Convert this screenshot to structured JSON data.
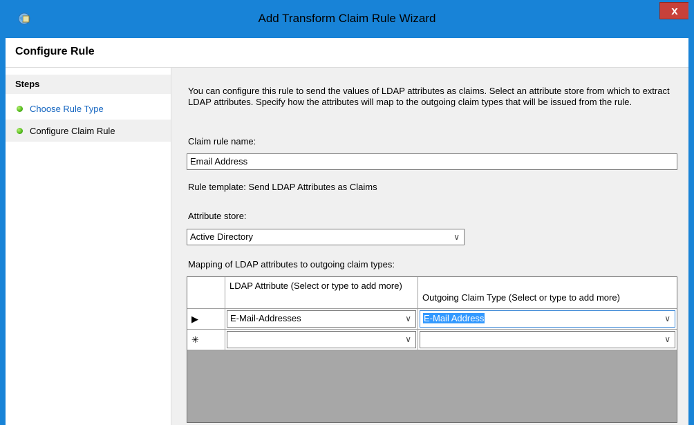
{
  "window": {
    "title": "Add Transform Claim Rule Wizard",
    "close_label": "x",
    "icon": "claims-wizard-icon"
  },
  "header": {
    "title": "Configure Rule"
  },
  "steps": {
    "title": "Steps",
    "items": [
      {
        "label": "Choose Rule Type",
        "status_color": "#4fb81a",
        "link": true
      },
      {
        "label": "Configure Claim Rule",
        "status_color": "#4fb81a",
        "link": false,
        "current": true
      }
    ]
  },
  "main": {
    "description": "You can configure this rule to send the values of LDAP attributes as claims. Select an attribute store from which to extract LDAP attributes. Specify how the attributes will map to the outgoing claim types that will be issued from the rule.",
    "claim_rule_name_label": "Claim rule name:",
    "claim_rule_name_value": "Email Address",
    "rule_template": "Rule template: Send LDAP Attributes as Claims",
    "attribute_store_label": "Attribute store:",
    "attribute_store_value": "Active Directory",
    "mapping_label": "Mapping of LDAP attributes to outgoing claim types:",
    "grid": {
      "columns": [
        "LDAP Attribute (Select or type to add more)",
        "Outgoing Claim Type (Select or type to add more)"
      ],
      "rows": [
        {
          "marker": "▶",
          "ldap": "E-Mail-Addresses",
          "claim": "E-Mail Address"
        },
        {
          "marker": "✳",
          "ldap": "",
          "claim": ""
        }
      ]
    }
  },
  "colors": {
    "title_bar": "#1883d7",
    "close_button": "#c8413a",
    "link": "#1465c0",
    "selection": "#3399ff"
  }
}
